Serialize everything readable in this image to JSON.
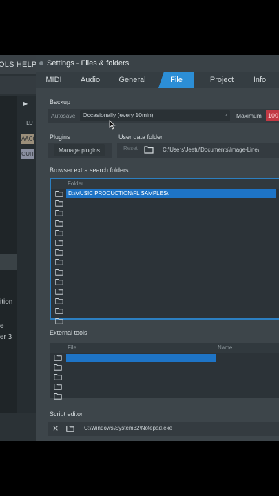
{
  "background_app": {
    "menu_text": "OLS  HELP",
    "tags": [
      "AACC",
      "GUIT"
    ],
    "side_texts": [
      "ition",
      "e",
      "er 3"
    ]
  },
  "window": {
    "title": "Settings - Files & folders"
  },
  "tabs": [
    {
      "label": "MIDI",
      "active": false
    },
    {
      "label": "Audio",
      "active": false
    },
    {
      "label": "General",
      "active": false
    },
    {
      "label": "File",
      "active": true
    },
    {
      "label": "Project",
      "active": false
    },
    {
      "label": "Info",
      "active": false
    }
  ],
  "backup": {
    "section_label": "Backup",
    "autosave_label": "Autosave",
    "autosave_value": "Occasionally (every 10min)",
    "maximum_label": "Maximum",
    "maximum_value": "100"
  },
  "plugins": {
    "section_label": "Plugins",
    "manage_button": "Manage plugins"
  },
  "user_data_folder": {
    "section_label": "User data folder",
    "reset_label": "Reset",
    "path": "C:\\Users\\Jeetu\\Documents\\Image-Line\\"
  },
  "browser_extra_search_folders": {
    "section_label": "Browser extra search folders",
    "column_header": "Folder",
    "rows": [
      "D:\\MUSIC PRODUCTION\\FL SAMPLES\\",
      "",
      "",
      "",
      "",
      "",
      "",
      "",
      "",
      "",
      "",
      "",
      "",
      ""
    ]
  },
  "external_tools": {
    "section_label": "External tools",
    "file_header": "File",
    "name_header": "Name",
    "rows": 5
  },
  "script_editor": {
    "section_label": "Script editor",
    "path": "C:\\Windows\\System32\\Notepad.exe"
  },
  "colors": {
    "accent": "#2c8ed6",
    "selection": "#1e74c6",
    "maximum_field": "#c23a45",
    "window_bg": "#3d454a"
  }
}
